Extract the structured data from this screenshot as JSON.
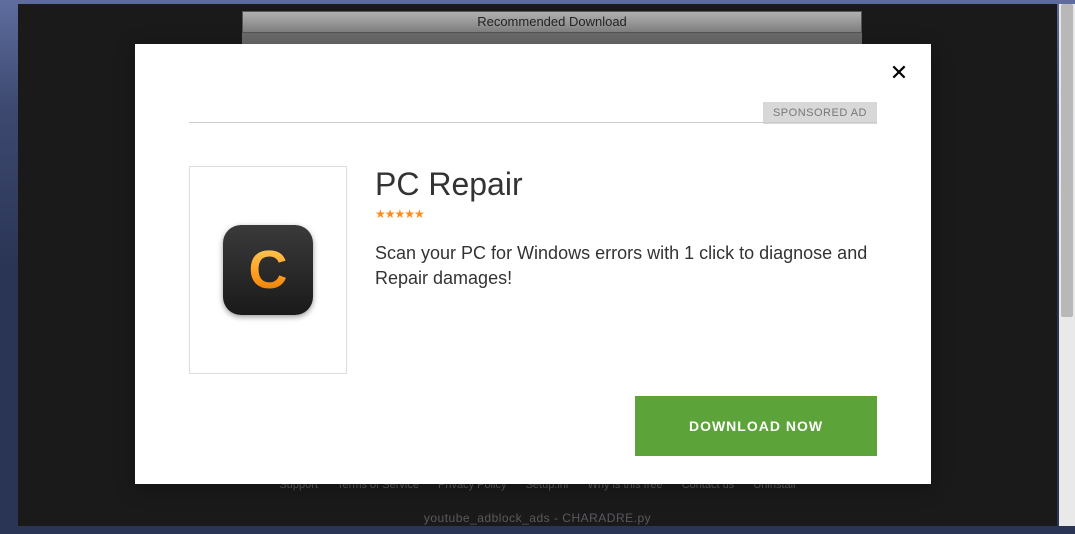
{
  "banner": {
    "title": "Recommended Download"
  },
  "footer": {
    "links": [
      "Support",
      "Terms of Service",
      "Privacy Policy",
      "Setup.ini",
      "Why is this free",
      "Contact us",
      "Uninstall"
    ],
    "bottom_text": "youtube_adblock_ads - CHARADRE.py"
  },
  "modal": {
    "sponsor_label": "SPONSORED AD",
    "close_glyph": "✕",
    "product": {
      "name": "PC Repair",
      "stars": "★★★★★",
      "description": "Scan your PC for Windows errors with 1 click to diagnose and Repair damages!",
      "icon_letter": "C"
    },
    "download_label": "DOWNLOAD NOW"
  }
}
